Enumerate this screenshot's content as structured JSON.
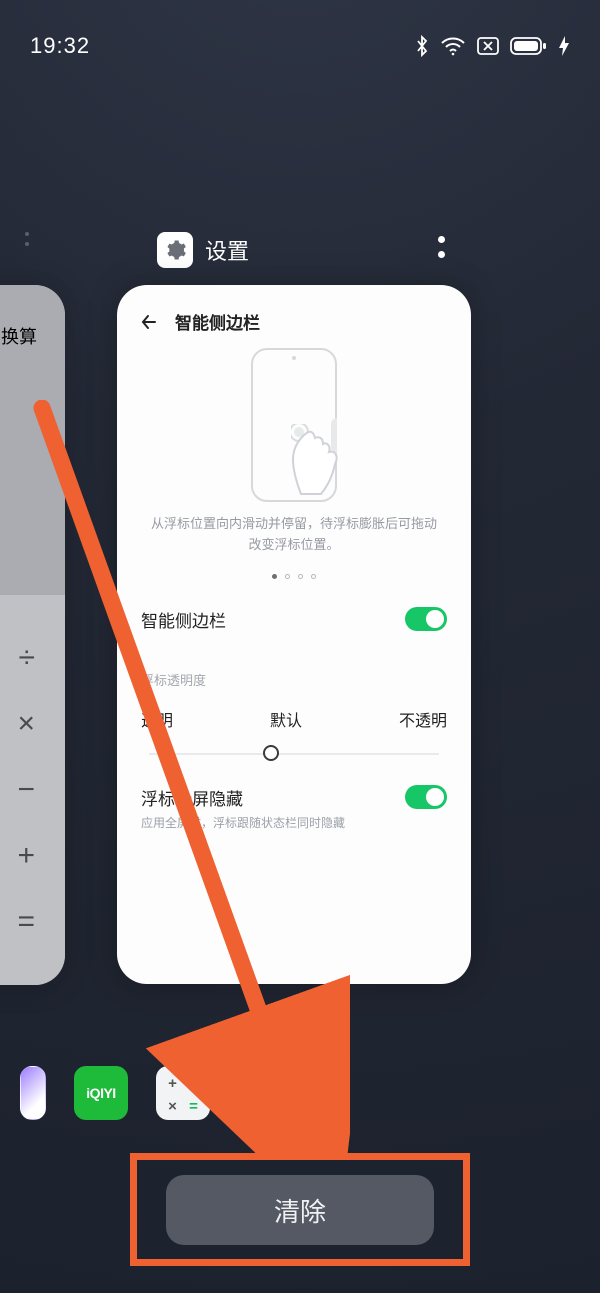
{
  "status": {
    "time": "19:32"
  },
  "apps": {
    "settings_label": "设置",
    "calc_sliver_label": "换算"
  },
  "settings_card": {
    "page_title": "智能侧边栏",
    "hint": "从浮标位置向内滑动并停留，待浮标膨胀后可拖动改变浮标位置。",
    "toggle_main_label": "智能侧边栏",
    "opacity_section": "浮标透明度",
    "slider": {
      "left": "透明",
      "mid": "默认",
      "right": "不透明"
    },
    "toggle_hide": {
      "title": "浮标全屏隐藏",
      "sub": "应用全屏时，浮标跟随状态栏同时隐藏"
    }
  },
  "dock": {
    "iqiyi": "iQIYI"
  },
  "clear_button": "清除"
}
